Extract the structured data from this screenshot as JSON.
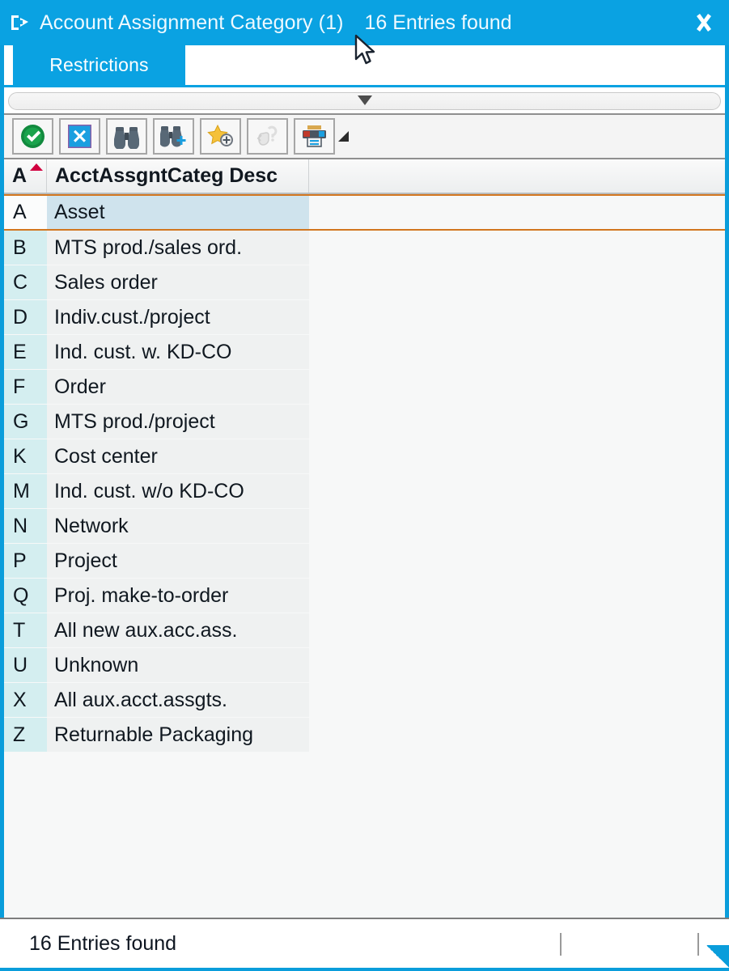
{
  "window": {
    "title": "Account Assignment Category (1)",
    "entries_found": "16 Entries found",
    "icon": "exit-arrow-icon",
    "close_label": "Close",
    "accent_color": "#0aa2e2",
    "border_color": "#0a9ddb"
  },
  "tabs": [
    {
      "label": "Restrictions",
      "active": true
    }
  ],
  "restriction_bar": {
    "collapse_icon": "triangle-down-icon"
  },
  "toolbar": {
    "buttons": [
      {
        "name": "copy-button",
        "icon": "green-check-circle-icon",
        "enabled": true
      },
      {
        "name": "cancel-button",
        "icon": "blue-x-square-icon",
        "enabled": true
      },
      {
        "name": "find-button",
        "icon": "binoculars-icon",
        "enabled": true
      },
      {
        "name": "find-next-button",
        "icon": "binoculars-plus-icon",
        "enabled": true
      },
      {
        "name": "insert-in-personal-list-button",
        "icon": "star-plus-icon",
        "enabled": true
      },
      {
        "name": "help-button",
        "icon": "hand-question-icon",
        "enabled": false
      },
      {
        "name": "print-button",
        "icon": "printer-icon",
        "enabled": true
      }
    ],
    "print_menu_icon": "caret-corner-icon"
  },
  "table": {
    "columns": [
      {
        "key": "key",
        "label": "A",
        "sorted": "asc"
      },
      {
        "key": "desc",
        "label": "AcctAssgntCateg Desc",
        "sorted": ""
      }
    ],
    "selected_index": 0,
    "rows": [
      {
        "key": "A",
        "desc": "Asset"
      },
      {
        "key": "B",
        "desc": "MTS prod./sales ord."
      },
      {
        "key": "C",
        "desc": "Sales order"
      },
      {
        "key": "D",
        "desc": "Indiv.cust./project"
      },
      {
        "key": "E",
        "desc": "Ind. cust. w. KD-CO"
      },
      {
        "key": "F",
        "desc": "Order"
      },
      {
        "key": "G",
        "desc": "MTS prod./project"
      },
      {
        "key": "K",
        "desc": "Cost center"
      },
      {
        "key": "M",
        "desc": "Ind. cust. w/o KD-CO"
      },
      {
        "key": "N",
        "desc": "Network"
      },
      {
        "key": "P",
        "desc": "Project"
      },
      {
        "key": "Q",
        "desc": "Proj. make-to-order"
      },
      {
        "key": "T",
        "desc": "All new aux.acc.ass."
      },
      {
        "key": "U",
        "desc": "Unknown"
      },
      {
        "key": "X",
        "desc": "All aux.acct.assgts."
      },
      {
        "key": "Z",
        "desc": "Returnable Packaging"
      }
    ]
  },
  "statusbar": {
    "message": "16 Entries found",
    "resize_grip": "resize-grip-icon"
  }
}
